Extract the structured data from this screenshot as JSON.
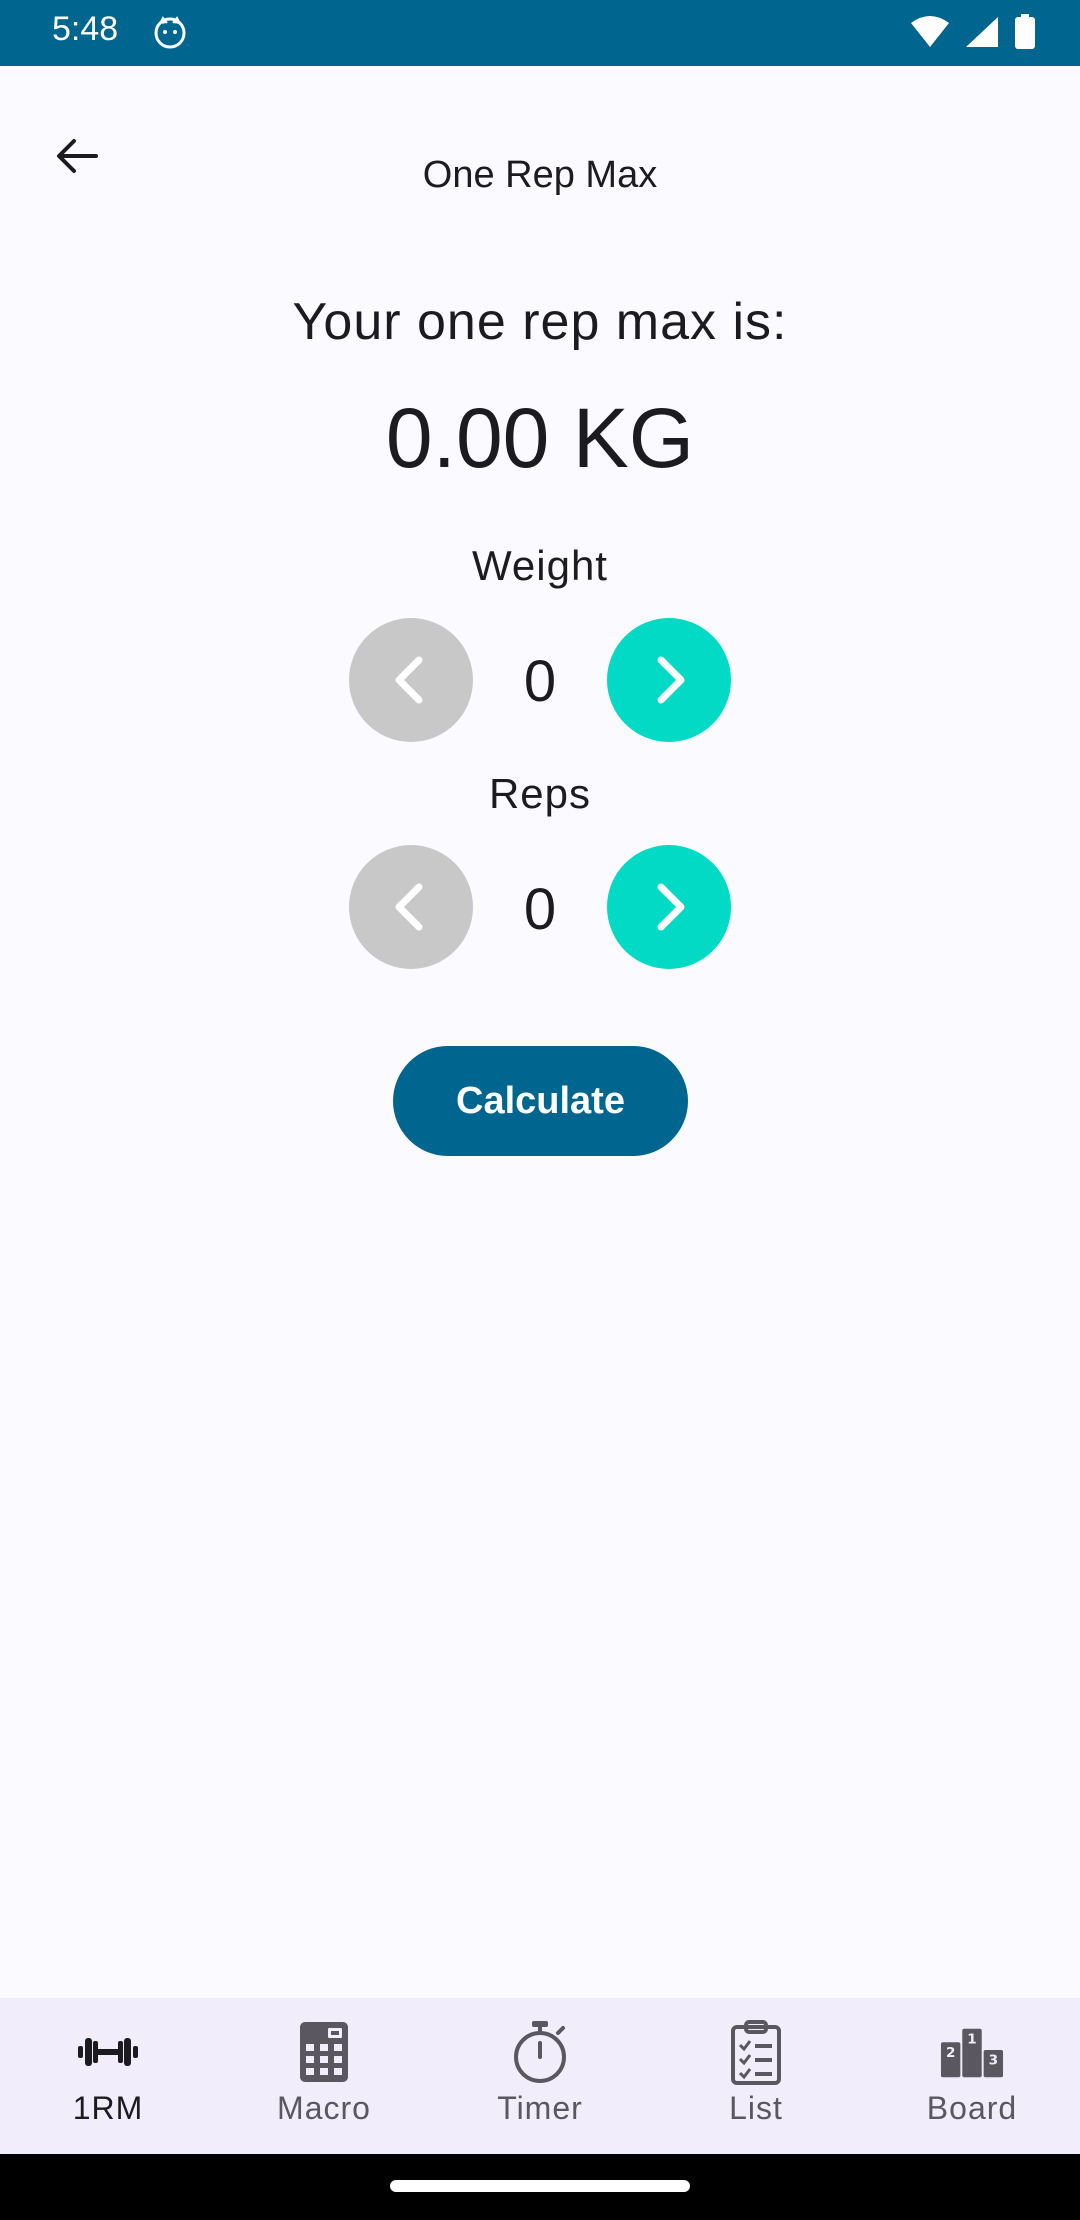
{
  "status_bar": {
    "time": "5:48",
    "color": "#00658F"
  },
  "app_bar": {
    "title": "One Rep Max"
  },
  "result": {
    "label": "Your one rep max is:",
    "value": "0.00 KG"
  },
  "weight": {
    "label": "Weight",
    "value": "0"
  },
  "reps": {
    "label": "Reps",
    "value": "0"
  },
  "calculate_label": "Calculate",
  "colors": {
    "primary": "#00658F",
    "accent": "#03DAC5",
    "disabled": "#C8C8C8",
    "nav_background": "#F2EDFA",
    "background": "#FBFAFE"
  },
  "nav": {
    "items": [
      {
        "label": "1RM",
        "icon": "dumbbell-icon",
        "active": true
      },
      {
        "label": "Macro",
        "icon": "calculator-icon",
        "active": false
      },
      {
        "label": "Timer",
        "icon": "stopwatch-icon",
        "active": false
      },
      {
        "label": "List",
        "icon": "clipboard-list-icon",
        "active": false
      },
      {
        "label": "Board",
        "icon": "leaderboard-icon",
        "active": false
      }
    ]
  }
}
